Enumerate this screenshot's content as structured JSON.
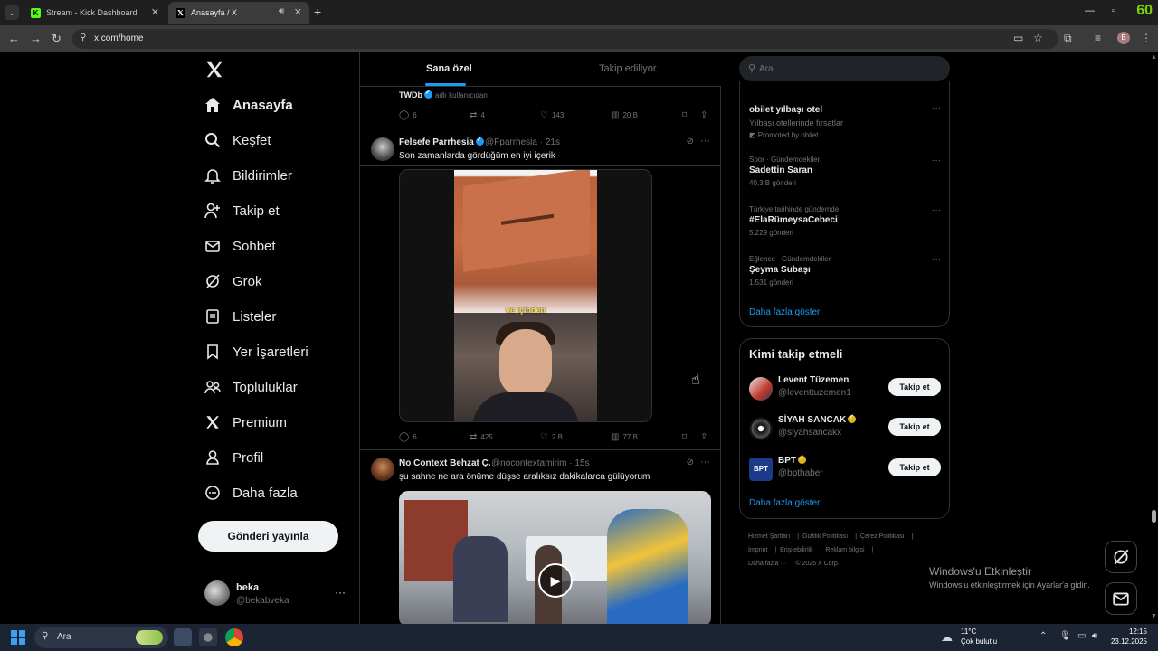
{
  "browser": {
    "tabs": [
      {
        "title": "Stream - Kick Dashboard",
        "favicon": "kick-icon",
        "active": false
      },
      {
        "title": "Anasayfa / X",
        "favicon": "x-icon",
        "active": true
      }
    ],
    "url": "x.com/home",
    "profile_initial": "B",
    "badge": "60"
  },
  "nav": {
    "items": [
      {
        "label": "Anasayfa",
        "icon": "home-icon"
      },
      {
        "label": "Keşfet",
        "icon": "search-icon"
      },
      {
        "label": "Bildirimler",
        "icon": "bell-icon"
      },
      {
        "label": "Takip et",
        "icon": "add-user-icon"
      },
      {
        "label": "Sohbet",
        "icon": "mail-icon"
      },
      {
        "label": "Grok",
        "icon": "grok-icon"
      },
      {
        "label": "Listeler",
        "icon": "list-icon"
      },
      {
        "label": "Yer İşaretleri",
        "icon": "bookmark-icon"
      },
      {
        "label": "Topluluklar",
        "icon": "communities-icon"
      },
      {
        "label": "Premium",
        "icon": "x-premium-icon"
      },
      {
        "label": "Profil",
        "icon": "profile-icon"
      },
      {
        "label": "Daha fazla",
        "icon": "more-circle-icon"
      }
    ],
    "post_button": "Gönderi yayınla",
    "account": {
      "name": "beka",
      "handle": "@bekabveka"
    }
  },
  "feed": {
    "tabs": [
      "Sana özel",
      "Takip ediliyor"
    ],
    "tweets": [
      {
        "name": "TWDb",
        "note": "adlı kullanıcıdan",
        "stats": {
          "replies": "6",
          "reposts": "4",
          "likes": "143",
          "views": "20 B"
        }
      },
      {
        "name": "Felsefe Parrhesia",
        "handle": "@Fparrhesia",
        "time": "· 21s",
        "text": "Son zamanlarda gördüğüm en iyi içerik",
        "video_caption": "ve içinden",
        "stats": {
          "replies": "6",
          "reposts": "425",
          "likes": "2 B",
          "views": "77 B"
        }
      },
      {
        "name": "No Context Behzat Ç.",
        "handle": "@nocontextamirim",
        "time": "· 15s",
        "text": "şu sahne ne ara önüme düşse aralıksız dakikalarca gülüyorum"
      }
    ]
  },
  "search": {
    "placeholder": "Ara"
  },
  "trends": {
    "items": [
      {
        "title": "obilet yılbaşı otel",
        "context": "Yılbaşı otellerinde fırsatlar",
        "meta": "Promoted by obilet"
      },
      {
        "context": "Spor · Gündemdekiler",
        "title": "Sadettin Saran",
        "meta": "40,3 B gönderi"
      },
      {
        "context": "Türkiye tarihinde gündemde",
        "title": "#ElaRümeysaCebeci",
        "meta": "5.229 gönderi"
      },
      {
        "context": "Eğlence · Gündemdekiler",
        "title": "Şeyma Subaşı",
        "meta": "1.531 gönderi"
      }
    ],
    "show_more": "Daha fazla göster"
  },
  "who_to_follow": {
    "title": "Kimi takip etmeli",
    "users": [
      {
        "name": "Levent Tüzemen",
        "handle": "@leventtuzemen1",
        "button": "Takip et"
      },
      {
        "name": "SİYAH SANCAK",
        "handle": "@siyahsancakx",
        "button": "Takip et"
      },
      {
        "name": "BPT",
        "handle": "@bpthaber",
        "button": "Takip et"
      }
    ],
    "show_more": "Daha fazla göster"
  },
  "footer": {
    "links": [
      "Hizmet Şartları",
      "Gizlilik Politikası",
      "Çerez Politikası",
      "İmprint",
      "Erişilebilirlik",
      "Reklam bilgisi",
      "Daha fazla ···"
    ],
    "copyright": "© 2025 X Corp."
  },
  "windows": {
    "activate_title": "Windows'u Etkinleştir",
    "activate_sub": "Windows'u etkinleştirmek için Ayarlar'a gidin.",
    "search_placeholder": "Ara",
    "temp": "11°C",
    "condition": "Çok bulutlu",
    "time": "12:15",
    "date": "23.12.2025"
  },
  "colors": {
    "accent": "#1d9bf0",
    "background": "#000000",
    "kick_green": "#53fc18"
  }
}
